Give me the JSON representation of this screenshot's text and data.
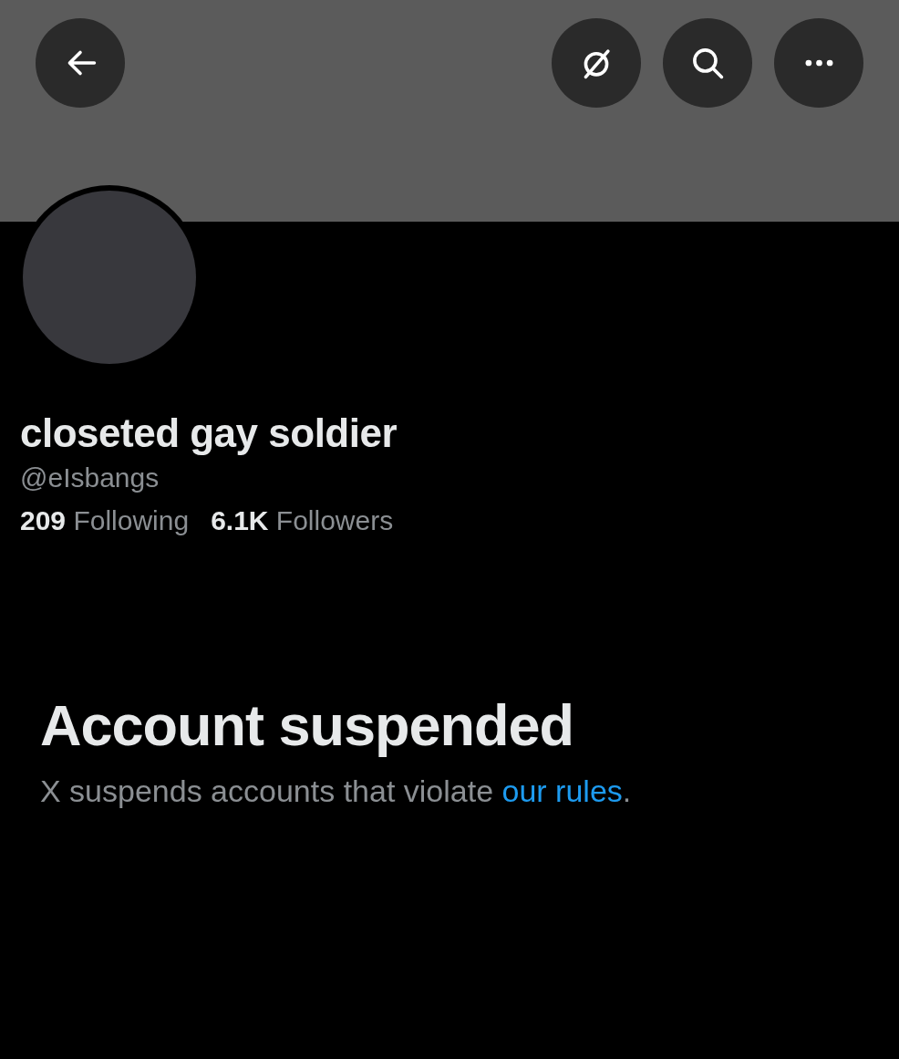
{
  "header": {
    "buttons": [
      {
        "kind": "back"
      },
      {
        "kind": "grok"
      },
      {
        "kind": "search"
      },
      {
        "kind": "more"
      }
    ]
  },
  "profile": {
    "name": "closeted gay soldier",
    "handle": "@eIsbangs",
    "stats": [
      "**209** Following",
      "**6.1K** Followers"
    ]
  },
  "notice": {
    "title": "Account suspended",
    "text": "X suspends accounts that violate ",
    "link": "our rules",
    "end": "."
  }
}
